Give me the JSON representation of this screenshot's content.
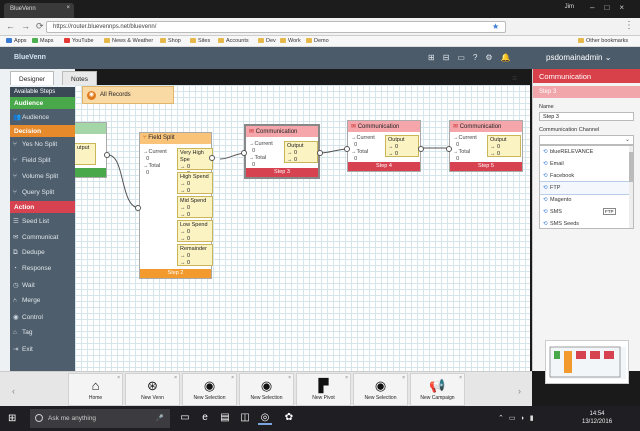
{
  "browser": {
    "tab_title": "BlueVenn",
    "user_name": "Jim",
    "url": "https://router.bluevennps.net/bluevenn/",
    "bookmarks": [
      "Apps",
      "Maps",
      "YouTube",
      "News & Weather",
      "Shop",
      "Sites",
      "Accounts",
      "Dev",
      "Work",
      "Demo"
    ],
    "other_bookmarks": "Other bookmarks"
  },
  "app": {
    "logo": "BlueVenn",
    "user": "psdomainadmin"
  },
  "left_panel": {
    "tabs": [
      "Designer",
      "Notes"
    ],
    "title": "Available Steps",
    "sections": {
      "audience": "Audience",
      "decision": "Decision",
      "action": "Action"
    },
    "audience_items": [
      "Audience"
    ],
    "decision_items": [
      "Yes No Split",
      "Field Split",
      "Volume Split",
      "Query Split"
    ],
    "action_items": [
      "Seed List",
      "Communicat",
      "Dedupe",
      "Response",
      "Wait",
      "Merge",
      "Control",
      "Tag",
      "Exit"
    ]
  },
  "canvas": {
    "all_records": "All Records",
    "partial_node": {
      "out_label": "utput"
    },
    "field_split": {
      "title": "Field Split",
      "current": "Current",
      "current_val": "0",
      "total": "Total",
      "total_val": "0",
      "outputs": [
        {
          "label": "Very High Spe",
          "v1": "→ 0",
          "v2": "→ 0"
        },
        {
          "label": "High Spend",
          "v1": "→ 0",
          "v2": "→ 0"
        },
        {
          "label": "Mid Spend",
          "v1": "→ 0",
          "v2": "→ 0"
        },
        {
          "label": "Low Spend",
          "v1": "→ 0",
          "v2": "→ 0"
        },
        {
          "label": "Remainder",
          "v1": "→ 0",
          "v2": "→ 0"
        }
      ],
      "footer": "Step 2"
    },
    "comm_nodes": [
      {
        "title": "Communication",
        "current": "Current",
        "current_val": "0",
        "total": "Total",
        "total_val": "0",
        "output": "Output",
        "v1": "→ 0",
        "v2": "→ 0",
        "footer": "Step 3"
      },
      {
        "title": "Communication",
        "current": "Current",
        "current_val": "0",
        "total": "Total",
        "total_val": "0",
        "output": "Output",
        "v1": "→ 0",
        "v2": "→ 0",
        "footer": "Step 4"
      },
      {
        "title": "Communication",
        "current": "Current",
        "current_val": "0",
        "total": "Total",
        "total_val": "0",
        "output": "Output",
        "v1": "→ 0",
        "v2": "→ 0",
        "footer": "Step 5"
      }
    ]
  },
  "right_panel": {
    "title": "Communication",
    "subtitle": "Step 3",
    "name_label": "Name",
    "name_value": "Step 3",
    "channel_label": "Communication Channel",
    "channel_value": "",
    "options": [
      "blueRELEVANCE",
      "Email",
      "Facebook",
      "FTP",
      "Magento",
      "SMS",
      "SMS Seeds"
    ],
    "tooltip": "FTP"
  },
  "bottom_toolbar": [
    {
      "label": "Home",
      "icon": "home-icon"
    },
    {
      "label": "New Venn",
      "icon": "venn-icon"
    },
    {
      "label": "New Selection",
      "icon": "eye-icon"
    },
    {
      "label": "New Selection",
      "icon": "eye-icon"
    },
    {
      "label": "New Pivot",
      "icon": "pivot-icon"
    },
    {
      "label": "New Selection",
      "icon": "eye-icon"
    },
    {
      "label": "New Campaign",
      "icon": "megaphone-icon"
    }
  ],
  "taskbar": {
    "search_placeholder": "Ask me anything",
    "time": "14:54",
    "date": "13/12/2016"
  },
  "colors": {
    "audience": "#49a94a",
    "decision": "#e68a2c",
    "action": "#d6424f",
    "header": "#4c5b6a"
  }
}
